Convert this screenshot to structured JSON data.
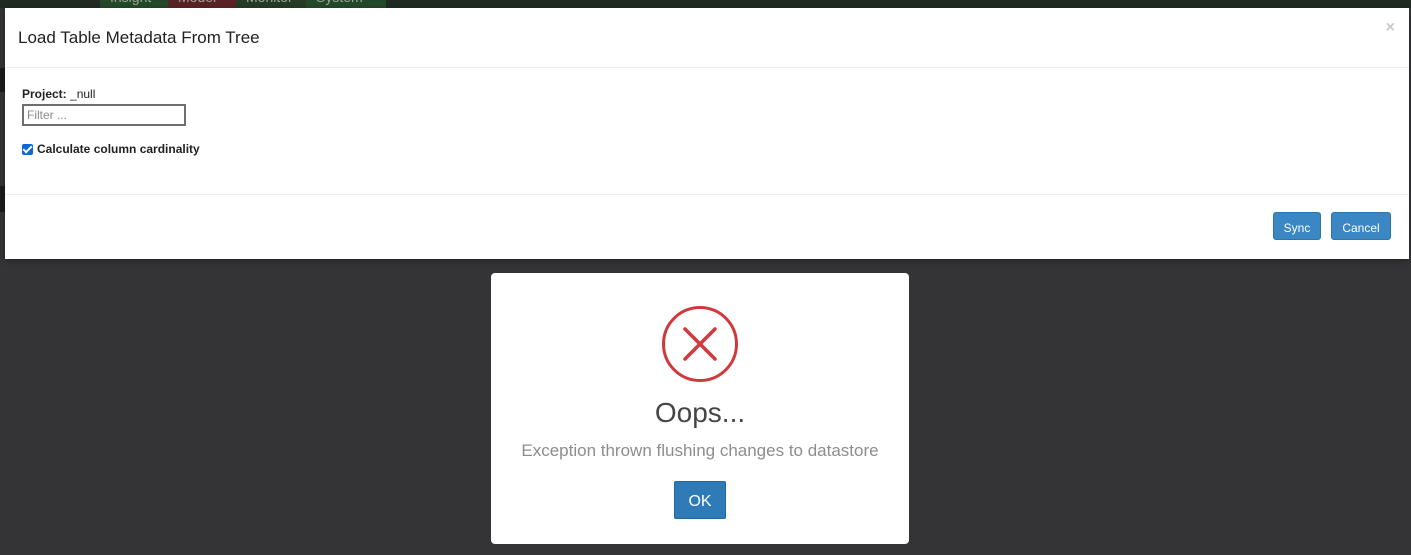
{
  "top_nav": {
    "tabs": [
      "Insight",
      "Model",
      "Monitor",
      "System"
    ]
  },
  "modal": {
    "title": "Load Table Metadata From Tree",
    "close_glyph": "×",
    "project_label": "Project:",
    "project_value": "_null",
    "filter_placeholder": "Filter ...",
    "filter_value": "",
    "checkbox_label": "Calculate column cardinality",
    "checkbox_checked": true,
    "sync_label": "Sync",
    "cancel_label": "Cancel"
  },
  "alert": {
    "icon": "error-x-icon",
    "title": "Oops...",
    "message": "Exception thrown flushing changes to datastore",
    "ok_label": "OK"
  },
  "colors": {
    "primary_button": "#3a87c4",
    "error_red": "#d0393e",
    "backdrop": "#343436"
  }
}
